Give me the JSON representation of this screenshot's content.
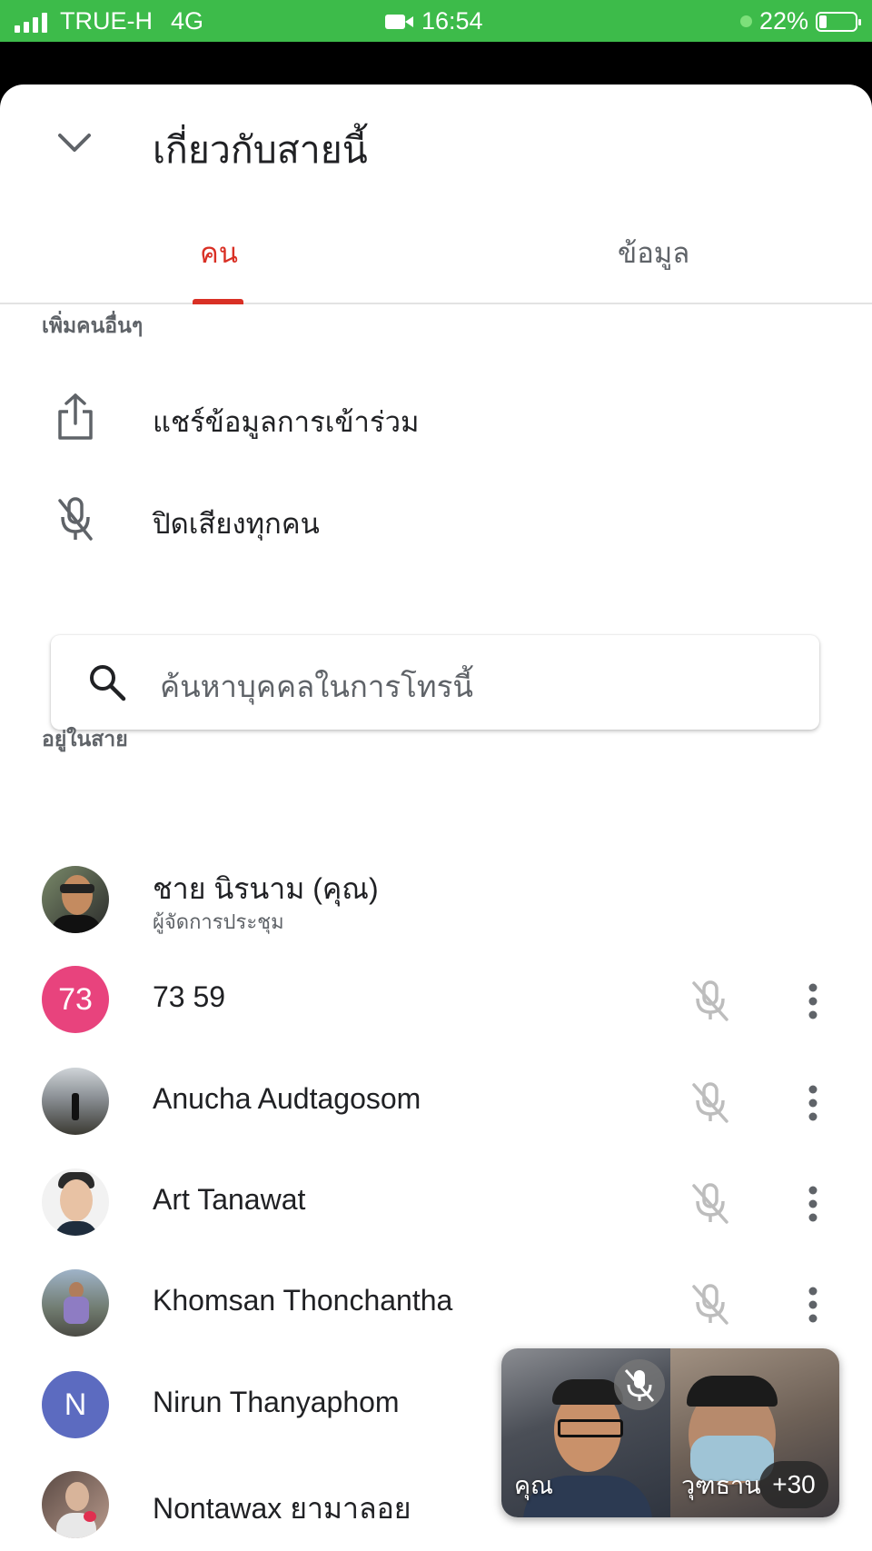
{
  "status_bar": {
    "carrier": "TRUE-H",
    "network": "4G",
    "time": "16:54",
    "battery": "22%"
  },
  "header": {
    "title": "เกี่ยวกับสายนี้"
  },
  "tabs": [
    {
      "label": "คน",
      "active": true
    },
    {
      "label": "ข้อมูล",
      "active": false
    }
  ],
  "add_people": {
    "section_label": "เพิ่มคนอื่นๆ",
    "share_label": "แชร์ข้อมูลการเข้าร่วม",
    "mute_all_label": "ปิดเสียงทุกคน"
  },
  "search": {
    "placeholder": "ค้นหาบุคคลในการโทรนี้"
  },
  "in_call": {
    "section_label": "อยู่ในสาย",
    "participants": [
      {
        "name": "ชาย นิรนาม (คุณ)",
        "role": "ผู้จัดการประชุม",
        "avatar": "photo"
      },
      {
        "name": "73 59",
        "avatar_text": "73",
        "avatar_color": "#e8437d"
      },
      {
        "name": "Anucha Audtagosom",
        "avatar": "photo"
      },
      {
        "name": "Art Tanawat",
        "avatar": "photo"
      },
      {
        "name": "Khomsan Thonchantha",
        "avatar": "photo"
      },
      {
        "name": "Nirun Thanyaphom",
        "avatar_text": "N",
        "avatar_color": "#5c6bc0"
      },
      {
        "name": "Nontawax ยามาลอย",
        "avatar": "photo"
      }
    ]
  },
  "pip": {
    "self_label": "คุณ",
    "other_label": "วุฑธาน",
    "more_count": "+30"
  },
  "colors": {
    "status_bar": "#3dbb4a",
    "accent": "#d93025",
    "muted_mic": "#bdbdbd"
  }
}
